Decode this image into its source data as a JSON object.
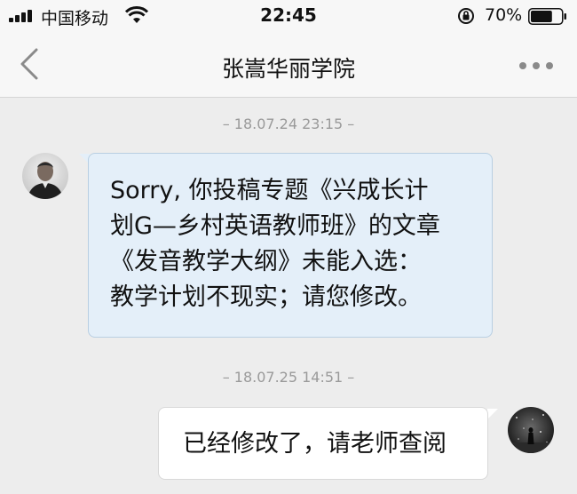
{
  "status_bar": {
    "carrier": "中国移动",
    "time": "22:45",
    "battery_percent": "70%",
    "battery_level": 0.7,
    "icons": [
      "signal-icon",
      "wifi-icon",
      "rotation-lock-icon",
      "battery-icon"
    ]
  },
  "nav": {
    "title": "张嵩华丽学院",
    "back_icon": "chevron-left-icon",
    "more_icon": "more-dots-icon"
  },
  "messages": [
    {
      "timestamp": "– 18.07.24 23:15 –",
      "direction": "incoming",
      "lines": [
        "Sorry, 你投稿专题《兴成长计",
        "划G—乡村英语教师班》的文章",
        "《发音教学大纲》未能入选：",
        "教学计划不现实；请您修改。"
      ]
    },
    {
      "timestamp": "– 18.07.25 14:51 –",
      "direction": "outgoing",
      "text": "已经修改了，请老师查阅"
    }
  ],
  "colors": {
    "incoming_bubble": "#e4eff9",
    "outgoing_bubble": "#ffffff",
    "background": "#ededed"
  }
}
